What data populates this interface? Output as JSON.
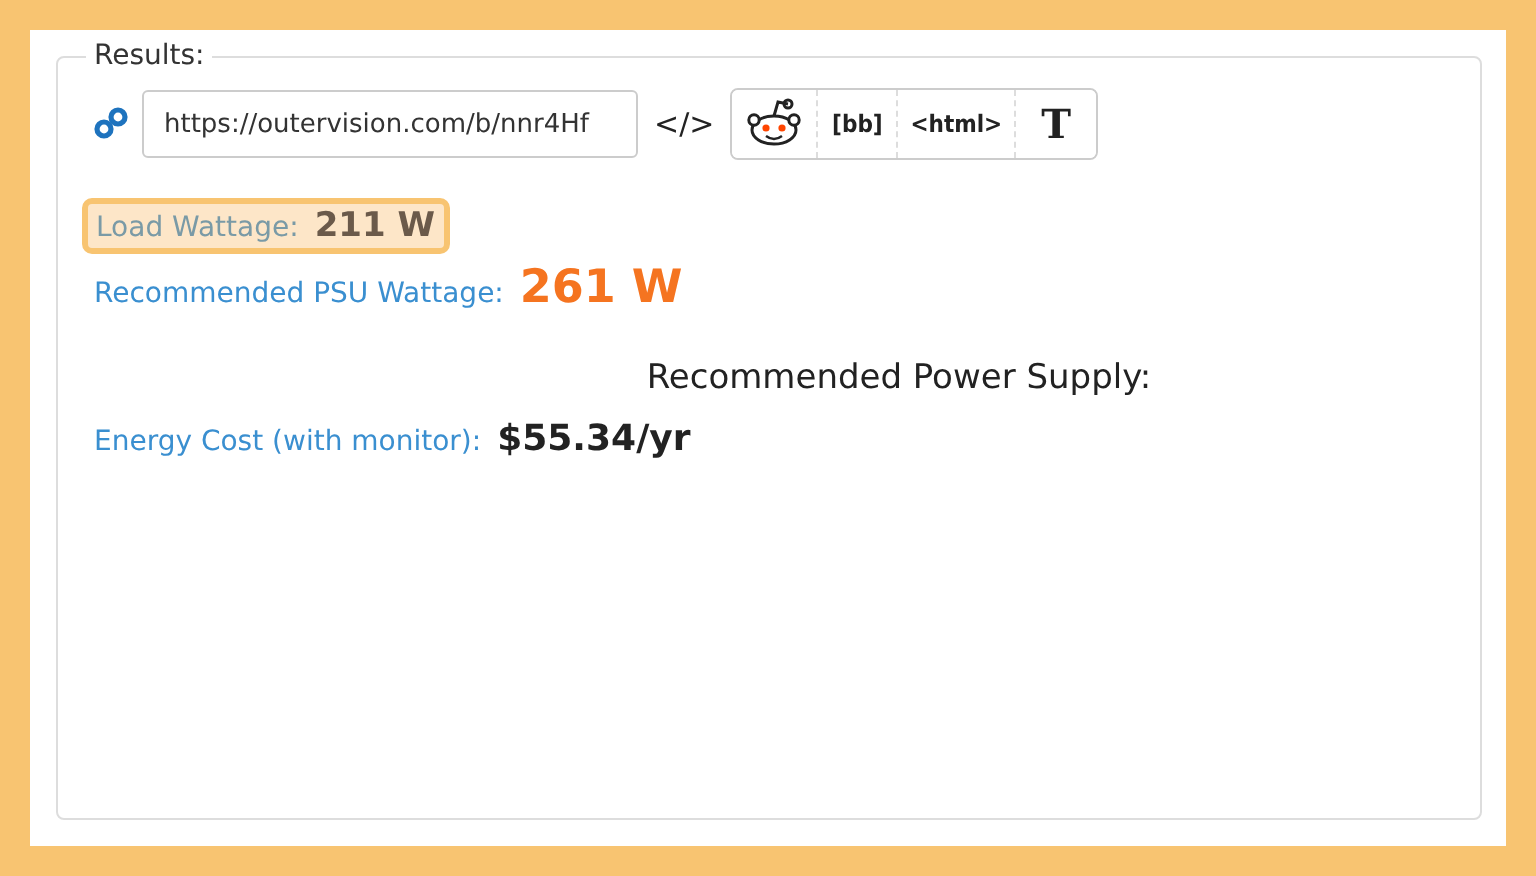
{
  "fieldset": {
    "legend": "Results:"
  },
  "share": {
    "url": "https://outervision.com/b/nnr4Hf",
    "embed": "</>",
    "buttons": [
      {
        "kind": "reddit"
      },
      {
        "kind": "text",
        "label": "[bb]"
      },
      {
        "kind": "text",
        "label": "<html>"
      },
      {
        "kind": "serif",
        "label": "T"
      }
    ]
  },
  "results": [
    {
      "kind": "highlight",
      "label": "Load Wattage:",
      "value": "211 W"
    },
    {
      "kind": "accent",
      "label": "Recommended PSU Wattage:",
      "value": "261 W"
    }
  ],
  "heading": "Recommended Power Supply:",
  "energy": {
    "label": "Energy Cost (with monitor):",
    "value": "$55.34/yr"
  }
}
